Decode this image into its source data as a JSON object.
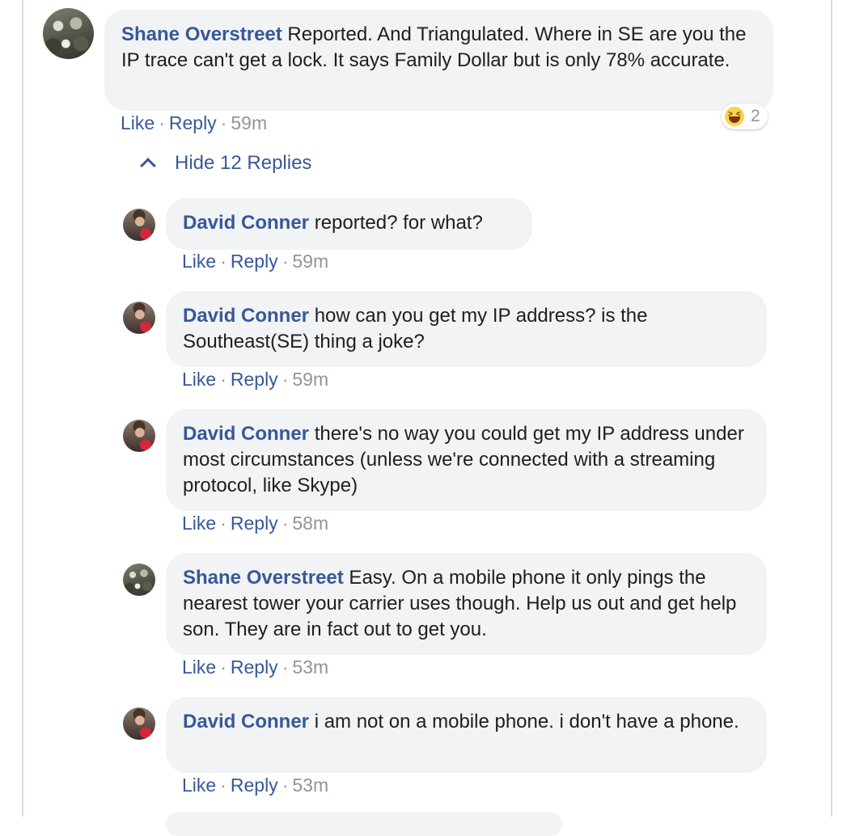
{
  "thread": {
    "top_comment": {
      "author": "Shane Overstreet",
      "text": " Reported. And Triangulated. Where in SE are you the IP trace can't get a lock. It says Family Dollar but is only 78% accurate.",
      "actions": {
        "like": "Like",
        "reply": "Reply",
        "time": "59m"
      },
      "reaction": {
        "icon": "haha-icon",
        "count": "2"
      }
    },
    "hide_replies_label": "Hide 12 Replies",
    "replies": [
      {
        "author": "David Conner",
        "text": " reported? for what?",
        "actions": {
          "like": "Like",
          "reply": "Reply",
          "time": "59m"
        }
      },
      {
        "author": "David Conner",
        "text": " how can you get my IP address? is the Southeast(SE) thing a joke?",
        "actions": {
          "like": "Like",
          "reply": "Reply",
          "time": "59m"
        }
      },
      {
        "author": "David Conner",
        "text": " there's no way you could get my IP address under most circumstances (unless we're connected with a streaming protocol, like Skype)",
        "actions": {
          "like": "Like",
          "reply": "Reply",
          "time": "58m"
        }
      },
      {
        "author": "Shane Overstreet",
        "text": " Easy. On a mobile phone it only pings the nearest tower your carrier uses though. Help us out and get help son. They are in fact out to get you.",
        "actions": {
          "like": "Like",
          "reply": "Reply",
          "time": "53m"
        }
      },
      {
        "author": "David Conner",
        "text": " i am not on a mobile phone. i don't have a phone.",
        "actions": {
          "like": "Like",
          "reply": "Reply",
          "time": "53m"
        }
      }
    ],
    "separator": "·"
  },
  "colors": {
    "link": "#385898",
    "bubble": "#f2f3f5",
    "meta": "#90949c",
    "text": "#1c1e21"
  }
}
